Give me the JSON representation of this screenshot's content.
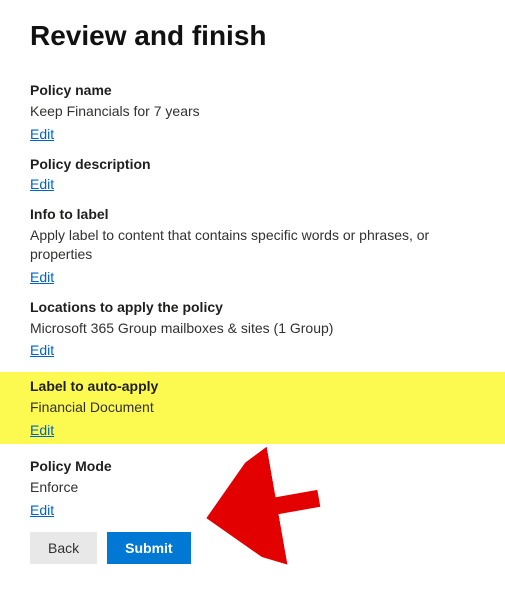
{
  "page_title": "Review and finish",
  "link_edit": "Edit",
  "sections": [
    {
      "heading": "Policy name",
      "value": "Keep Financials for 7 years",
      "highlighted": false
    },
    {
      "heading": "Policy description",
      "value": "",
      "highlighted": false
    },
    {
      "heading": "Info to label",
      "value": "Apply label to content that contains specific words or phrases, or properties",
      "highlighted": false
    },
    {
      "heading": "Locations to apply the policy",
      "value": "Microsoft 365 Group mailboxes & sites (1 Group)",
      "highlighted": false
    },
    {
      "heading": "Label to auto-apply",
      "value": "Financial Document",
      "highlighted": true
    },
    {
      "heading": "Policy Mode",
      "value": "Enforce",
      "highlighted": false
    }
  ],
  "buttons": {
    "back": "Back",
    "submit": "Submit"
  }
}
